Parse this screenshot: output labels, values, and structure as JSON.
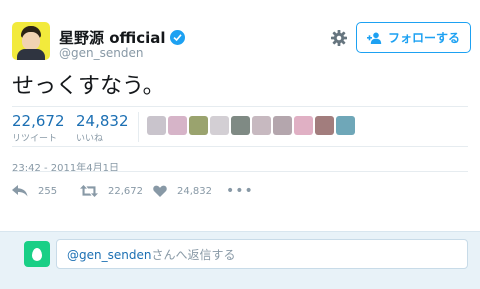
{
  "user": {
    "name": "星野源 official",
    "handle": "@gen_senden",
    "verified": true
  },
  "header": {
    "follow_label": "フォローする"
  },
  "tweet": {
    "text": "せっくすなう。",
    "timestamp": "23:42 - 2011年4月1日"
  },
  "stats": {
    "retweets": {
      "value": "22,672",
      "label": "リツイート"
    },
    "likes": {
      "value": "24,832",
      "label": "いいね"
    }
  },
  "likers": {
    "avatar_colors": [
      "#c9c4cc",
      "#d6b4c8",
      "#9aa36e",
      "#d3cfd4",
      "#7f8a84",
      "#c7b9c0",
      "#b4a6ad",
      "#e0b0c4",
      "#a27d7d",
      "#6fa7b8"
    ]
  },
  "actions": {
    "reply_count": "255",
    "retweet_count": "22,672",
    "like_count": "24,832",
    "more": "•••"
  },
  "reply": {
    "mention": "@gen_senden",
    "placeholder_rest": "さんへ返信する"
  },
  "colors": {
    "link": "#1b6fb3",
    "accent": "#1da1f2",
    "muted": "#8899a6",
    "reply_bg": "#e8f2f8",
    "egg_green": "#19cf86"
  }
}
